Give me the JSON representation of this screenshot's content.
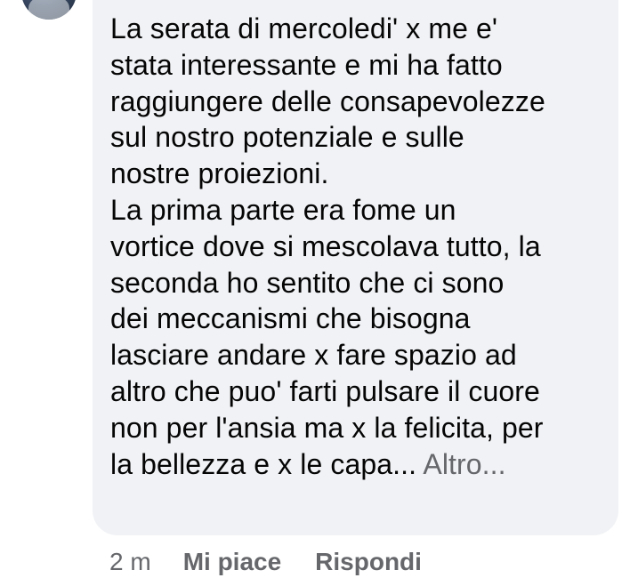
{
  "comment": {
    "lines": [
      "La serata di mercoledi' x me e'",
      "stata interessante e mi ha fatto",
      "raggiungere delle consapevolezze",
      "sul nostro potenziale e sulle",
      "nostre proiezioni.",
      "La prima parte era fome un",
      "vortice dove si mescolava tutto, la",
      "seconda ho sentito che ci sono",
      "dei meccanismi che bisogna",
      "lasciare andare x fare spazio ad",
      "altro che puo' farti pulsare il cuore",
      "non per l'ansia ma x la felicita, per"
    ],
    "last_line": "la bellezza e x le capa...",
    "more_label": "Altro..."
  },
  "actions": {
    "timestamp": "2 m",
    "like_label": "Mi piace",
    "reply_label": "Rispondi"
  },
  "colors": {
    "bubble": "#f0f2f5",
    "text": "#050505",
    "secondary": "#65676b"
  }
}
